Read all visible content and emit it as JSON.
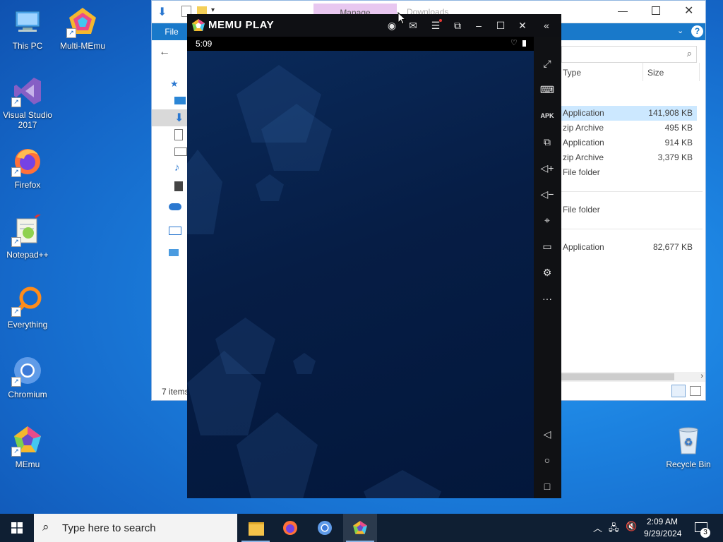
{
  "desktop": {
    "icons": [
      {
        "label": "This PC"
      },
      {
        "label": "Multi-MEmu"
      },
      {
        "label": "Visual Studio 2017"
      },
      {
        "label": "Firefox"
      },
      {
        "label": "Notepad++"
      },
      {
        "label": "Everything"
      },
      {
        "label": "Chromium"
      },
      {
        "label": "MEmu"
      },
      {
        "label": "Recycle Bin"
      }
    ]
  },
  "explorer": {
    "ribbon_tabs": {
      "manage": "Manage",
      "context": "Downloads"
    },
    "file_tab": "File",
    "columns": {
      "type": "Type",
      "size": "Size"
    },
    "rows": [
      {
        "type": "Application",
        "size": "141,908 KB",
        "selected": true
      },
      {
        "type": "zip Archive",
        "size": "495 KB"
      },
      {
        "type": "Application",
        "size": "914 KB"
      },
      {
        "type": "zip Archive",
        "size": "3,379 KB"
      },
      {
        "type": "File folder",
        "size": ""
      },
      {
        "type": "File folder",
        "size": ""
      },
      {
        "type": "Application",
        "size": "82,677 KB"
      }
    ],
    "status": "7 items"
  },
  "memu": {
    "brand": "MEMU PLAY",
    "time": "5:09"
  },
  "taskbar": {
    "search_placeholder": "Type here to search",
    "clock_time": "2:09 AM",
    "clock_date": "9/29/2024",
    "notification_count": "3"
  },
  "colors": {
    "desktop_blue": "#1c82e0",
    "explorer_ribbon": "#1979ca",
    "memu_bar": "#0f1014",
    "taskbar": "#0f1f33",
    "selection": "#cce8ff"
  }
}
